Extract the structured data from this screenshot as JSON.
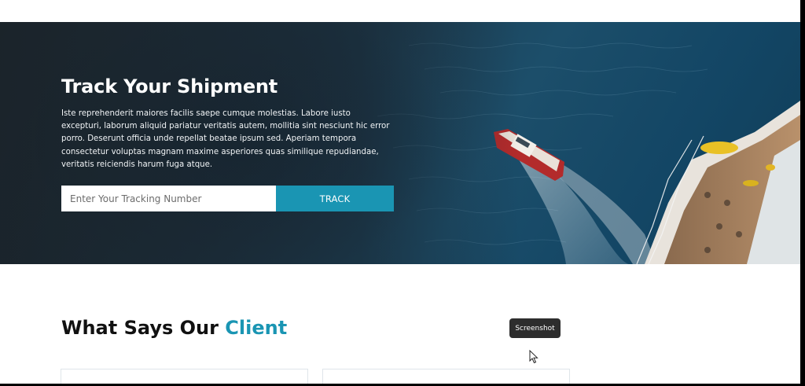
{
  "hero": {
    "title": "Track Your Shipment",
    "description": "Iste reprehenderit maiores facilis saepe cumque molestias. Labore iusto excepturi, laborum aliquid pariatur veritatis autem, mollitia sint nesciunt hic error porro. Deserunt officia unde repellat beatae ipsum sed. Aperiam tempora consectetur voluptas magnam maxime asperiores quas similique repudiandae, veritatis reiciendis harum fuga atque.",
    "tracking_placeholder": "Enter Your Tracking Number",
    "track_button": "TRACK",
    "image_icon": "ship-photo"
  },
  "clients": {
    "title_prefix": "What Says Our ",
    "title_accent": "Client"
  },
  "overlay": {
    "tooltip": "Screenshot",
    "cursor_icon": "pointer-cursor-icon"
  },
  "colors": {
    "accent": "#1a95b3",
    "hero_dark": "#1f2d36",
    "tooltip_bg": "#2d2d2d"
  }
}
